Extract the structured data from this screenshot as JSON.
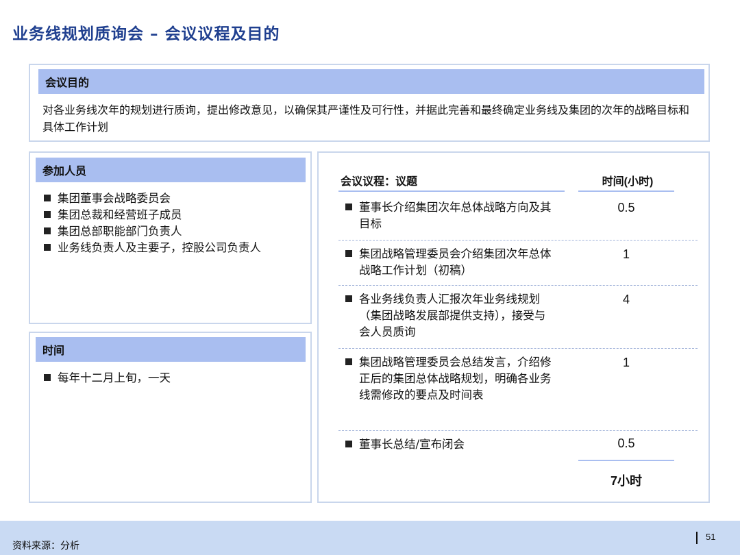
{
  "page_title": "业务线规划质询会 – 会议议程及目的",
  "purpose": {
    "heading": "会议目的",
    "text": "对各业务线次年的规划进行质询，提出修改意见，以确保其严谨性及可行性，并据此完善和最终确定业务线及集团的次年的战略目标和具体工作计划"
  },
  "participants": {
    "heading": "参加人员",
    "items": [
      "集团董事会战略委员会",
      "集团总裁和经营班子成员",
      "集团总部职能部门负责人",
      "业务线负责人及主要子，控股公司负责人"
    ]
  },
  "timing": {
    "heading": "时间",
    "items": [
      "每年十二月上旬，一天"
    ]
  },
  "agenda": {
    "topic_header": "会议议程：议题",
    "time_header": "时间(小时)",
    "rows": [
      {
        "topic": "董事长介绍集团次年总体战略方向及其目标",
        "hours": "0.5"
      },
      {
        "topic": "集团战略管理委员会介绍集团次年总体战略工作计划（初稿）",
        "hours": "1"
      },
      {
        "topic": "各业务线负责人汇报次年业务线规划（集团战略发展部提供支持），接受与会人员质询",
        "hours": "4"
      },
      {
        "topic": "集团战略管理委员会总结发言，介绍修正后的集团总体战略规划，明确各业务线需修改的要点及时间表",
        "hours": "1"
      },
      {
        "topic": "董事长总结/宣布闭会",
        "hours": "0.5"
      }
    ],
    "total": "7小时"
  },
  "footer": {
    "source": "资料来源：分析",
    "page_number": "51"
  }
}
